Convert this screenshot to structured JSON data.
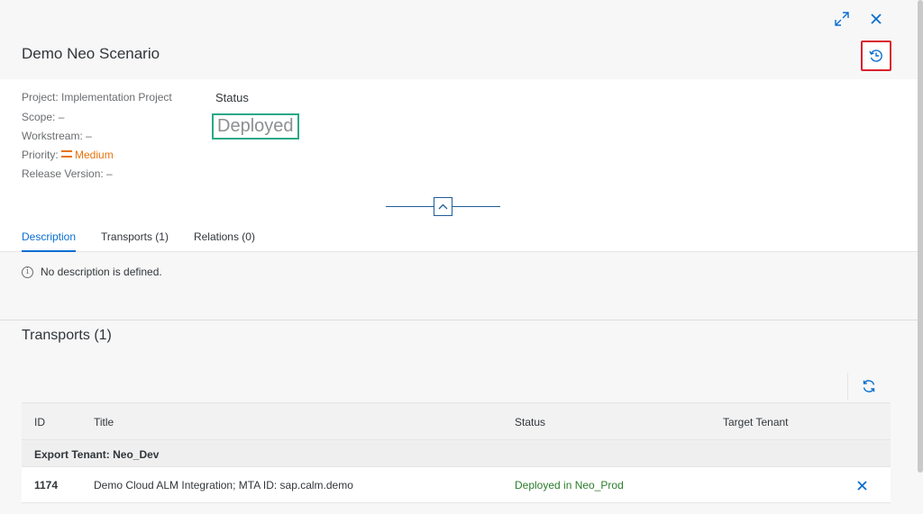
{
  "header": {
    "title": "Demo Neo Scenario"
  },
  "details": {
    "project": "Project: Implementation Project",
    "scope": "Scope: –",
    "workstream": "Workstream: –",
    "priority_label": "Priority:",
    "priority_value": "Medium",
    "release_version": "Release Version: –",
    "status_label": "Status",
    "status_value": "Deployed"
  },
  "tabs": [
    {
      "label": "Description",
      "active": true
    },
    {
      "label": "Transports (1)",
      "active": false
    },
    {
      "label": "Relations (0)",
      "active": false
    }
  ],
  "description": {
    "message": "No description is defined."
  },
  "transports": {
    "title": "Transports (1)",
    "columns": [
      "ID",
      "Title",
      "Status",
      "Target Tenant"
    ],
    "group_label": "Export Tenant: Neo_Dev",
    "rows": [
      {
        "id": "1174",
        "title": "Demo Cloud ALM Integration; MTA ID: sap.calm.demo",
        "status": "Deployed in Neo_Prod",
        "target": ""
      }
    ]
  },
  "colors": {
    "accent": "#0a6ed1",
    "priority_medium": "#e9730c",
    "success": "#2b7d2b",
    "highlight_red": "#d9232d",
    "highlight_green": "#2aa887"
  },
  "icons": {
    "expand": "expand-icon",
    "close": "close-icon",
    "history": "history-icon",
    "collapse": "chevron-up-icon",
    "info": "info-icon",
    "refresh": "refresh-icon",
    "remove": "remove-icon"
  }
}
